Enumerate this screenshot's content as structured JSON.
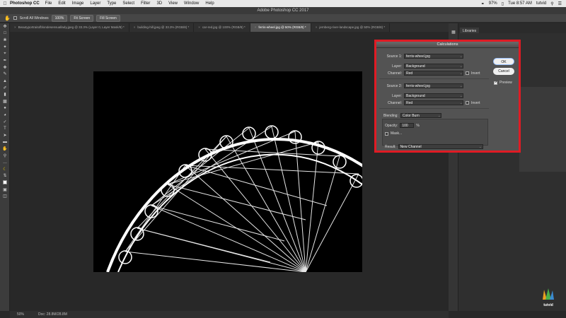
{
  "menubar": {
    "app_name": "Photoshop CC",
    "items": [
      "File",
      "Edit",
      "Image",
      "Layer",
      "Type",
      "Select",
      "Filter",
      "3D",
      "View",
      "Window",
      "Help"
    ],
    "battery": "97%",
    "time": "Tue 8:57 AM",
    "user": "tutvid"
  },
  "window_title": "Adobe Photoshop CC 2017",
  "options_bar": {
    "scroll_all_windows": "Scroll All Windows",
    "zoom": "100%",
    "fit_screen": "Fit Screen",
    "fill_screen": "Fill Screen"
  },
  "tabs": [
    {
      "label": "Beautyportraitofblondesensuallady.jpeg @ 33.3% (Layer 0, Layer Mask/8) *",
      "active": false
    },
    {
      "label": "building-hill.jpeg @ 33.3% (RGB/8) *",
      "active": false
    },
    {
      "label": "car-red.jpg @ 100% (RGB/8) *",
      "active": false
    },
    {
      "label": "ferris-wheel.jpg @ 50% (RGB/8) *",
      "active": true
    },
    {
      "label": "jernberg-river-landscape.jpg @ 50% (RGB/8) *",
      "active": false
    }
  ],
  "right_panel": {
    "libraries_tab": "Libraries"
  },
  "dialog": {
    "title": "Calculations",
    "source1": {
      "label": "Source 1:",
      "file": "ferris-wheel.jpg",
      "layer_label": "Layer:",
      "layer": "Background",
      "channel_label": "Channel:",
      "channel": "Red",
      "invert_label": "Invert"
    },
    "source2": {
      "label": "Source 2:",
      "file": "ferris-wheel.jpg",
      "layer_label": "Layer:",
      "layer": "Background",
      "channel_label": "Channel:",
      "channel": "Red",
      "invert_label": "Invert"
    },
    "blending_label": "Blending:",
    "blending": "Color Burn",
    "opacity_label": "Opacity:",
    "opacity": "100",
    "opacity_unit": "%",
    "mask_label": "Mask...",
    "result_label": "Result:",
    "result": "New Channel",
    "ok_label": "OK",
    "cancel_label": "Cancel",
    "preview_label": "Preview",
    "preview_checked": true,
    "highlight_color": "#e01b24"
  },
  "status_bar": {
    "zoom": "50%",
    "doc": "Doc: 28.8M/28.8M"
  },
  "watermark": {
    "text": "tutvid"
  }
}
